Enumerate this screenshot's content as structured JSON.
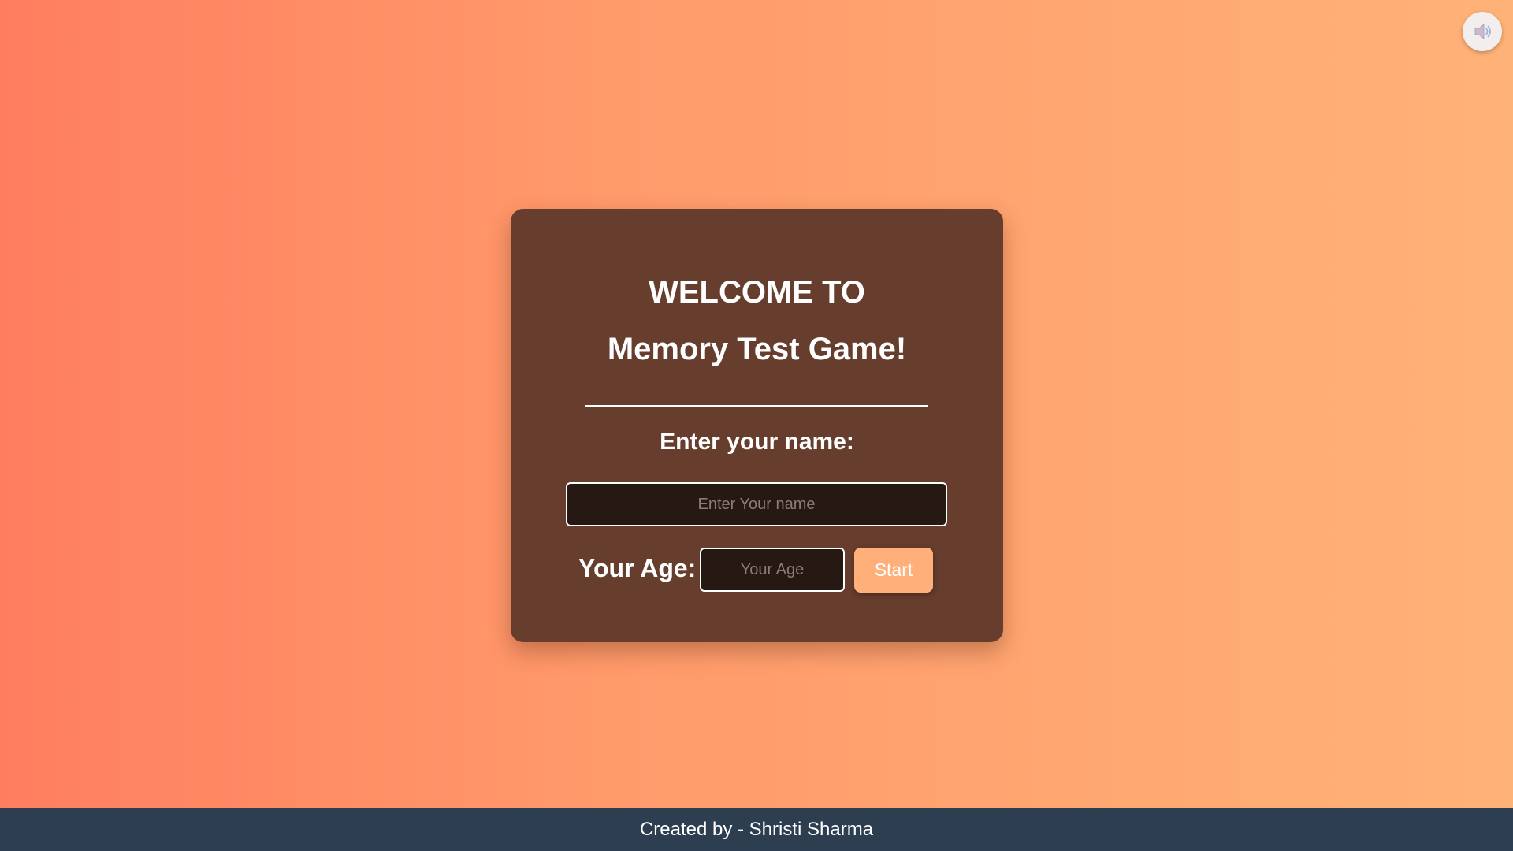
{
  "sound_toggle": {
    "icon": "speaker-icon"
  },
  "card": {
    "title_line1": "WELCOME TO",
    "title_line2": "Memory Test Game!",
    "name_label": "Enter your name:",
    "name_placeholder": "Enter Your name",
    "name_value": "",
    "age_label": "Your Age:",
    "age_placeholder": "Your Age",
    "age_value": "",
    "start_label": "Start"
  },
  "footer": {
    "text": "Created by - Shristi Sharma"
  },
  "colors": {
    "background_start": "#ff7e5f",
    "background_end": "#ffb277",
    "card_background": "#673d2d",
    "input_background": "#261812",
    "start_button": "#ffb07a",
    "footer_background": "#2d3e50"
  }
}
